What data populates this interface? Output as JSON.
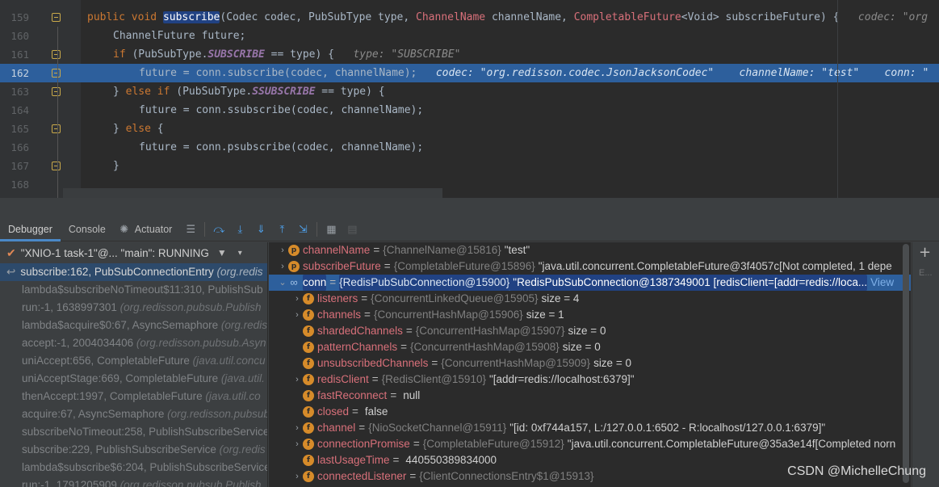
{
  "editor": {
    "line_numbers": [
      "159",
      "160",
      "161",
      "162",
      "163",
      "164",
      "165",
      "166",
      "167",
      "168"
    ],
    "lines": [
      {
        "parts": [
          [
            "kw",
            "public "
          ],
          [
            "kw",
            "void "
          ],
          [
            "sel",
            "subscribe"
          ],
          [
            "ty",
            "(Codec codec, PubSubType type, "
          ],
          [
            "red",
            "ChannelName"
          ],
          [
            "ty",
            " channelName, "
          ],
          [
            "red",
            "CompletableFuture"
          ],
          [
            "ty",
            "<Void> subscribeFuture) {   "
          ],
          [
            "hint",
            "codec: \"org"
          ]
        ]
      },
      {
        "parts": [
          [
            "ty",
            "ChannelFuture future;"
          ]
        ]
      },
      {
        "parts": [
          [
            "kw",
            "if "
          ],
          [
            "ty",
            "(PubSubType."
          ],
          [
            "en",
            "SUBSCRIBE"
          ],
          [
            "ty",
            " == type) {   "
          ],
          [
            "hint",
            "type: \"SUBSCRIBE\""
          ]
        ]
      },
      {
        "parts": [
          [
            "ty",
            "future = conn.subscribe(codec, channelName);   "
          ],
          [
            "hlnote",
            "codec: \"org.redisson.codec.JsonJacksonCodec\"    channelName: \"test\"    conn: \""
          ]
        ]
      },
      {
        "parts": [
          [
            "ty",
            "} "
          ],
          [
            "kw",
            "else if "
          ],
          [
            "ty",
            "(PubSubType."
          ],
          [
            "en",
            "SSUBSCRIBE"
          ],
          [
            "ty",
            " == type) {"
          ]
        ]
      },
      {
        "parts": [
          [
            "ty",
            "future = conn.ssubscribe(codec, channelName);"
          ]
        ]
      },
      {
        "parts": [
          [
            "ty",
            "} "
          ],
          [
            "kw",
            "else "
          ],
          [
            "ty",
            "{"
          ]
        ]
      },
      {
        "parts": [
          [
            "ty",
            "future = conn.psubscribe(codec, channelName);"
          ]
        ]
      },
      {
        "parts": [
          [
            "ty",
            "}"
          ]
        ]
      },
      {
        "parts": []
      }
    ]
  },
  "debug": {
    "tabs": {
      "debugger": "Debugger",
      "console": "Console",
      "actuator": "Actuator"
    },
    "thread": "\"XNIO-1 task-1\"@... \"main\": RUNNING",
    "frames": [
      {
        "method": "subscribe:162, PubSubConnectionEntry",
        "cls": "(org.redis"
      },
      {
        "method": "lambda$subscribeNoTimeout$11:310, PublishSub",
        "cls": ""
      },
      {
        "method": "run:-1, 1638997301",
        "cls": "(org.redisson.pubsub.Publish"
      },
      {
        "method": "lambda$acquire$0:67, AsyncSemaphore",
        "cls": "(org.redis"
      },
      {
        "method": "accept:-1, 2004034406",
        "cls": "(org.redisson.pubsub.Asyn"
      },
      {
        "method": "uniAccept:656, CompletableFuture",
        "cls": "(java.util.concu"
      },
      {
        "method": "uniAcceptStage:669, CompletableFuture",
        "cls": "(java.util."
      },
      {
        "method": "thenAccept:1997, CompletableFuture",
        "cls": "(java.util.co"
      },
      {
        "method": "acquire:67, AsyncSemaphore",
        "cls": "(org.redisson.pubsub"
      },
      {
        "method": "subscribeNoTimeout:258, PublishSubscribeService",
        "cls": ""
      },
      {
        "method": "subscribe:229, PublishSubscribeService",
        "cls": "(org.redis"
      },
      {
        "method": "lambda$subscribe$6:204, PublishSubscribeService",
        "cls": ""
      },
      {
        "method": "run:-1, 1791205909",
        "cls": "(org.redisson.pubsub.Publish"
      }
    ],
    "variables": [
      {
        "indent": 0,
        "arrow": "›",
        "icon": "p",
        "name": "channelName",
        "type": "{ChannelName@15816}",
        "value": "\"test\"",
        "selected": false
      },
      {
        "indent": 0,
        "arrow": "›",
        "icon": "p",
        "name": "subscribeFuture",
        "type": "{CompletableFuture@15896}",
        "value": "\"java.util.concurrent.CompletableFuture@3f4057c[Not completed, 1 depe",
        "selected": false
      },
      {
        "indent": 0,
        "arrow": "⌄",
        "icon": "oo",
        "name": "conn",
        "type": "{RedisPubSubConnection@15900}",
        "value": "\"RedisPubSubConnection@1387349001 [redisClient=[addr=redis://loca...",
        "link": "View",
        "selected": true
      },
      {
        "indent": 1,
        "arrow": "›",
        "icon": "f",
        "name": "listeners",
        "type": "{ConcurrentLinkedQueue@15905}",
        "value": "size = 4",
        "selected": false
      },
      {
        "indent": 1,
        "arrow": "›",
        "icon": "f",
        "name": "channels",
        "type": "{ConcurrentHashMap@15906}",
        "value": "size = 1",
        "selected": false
      },
      {
        "indent": 1,
        "arrow": "",
        "icon": "f",
        "name": "shardedChannels",
        "type": "{ConcurrentHashMap@15907}",
        "value": "size = 0",
        "selected": false
      },
      {
        "indent": 1,
        "arrow": "",
        "icon": "f",
        "name": "patternChannels",
        "type": "{ConcurrentHashMap@15908}",
        "value": "size = 0",
        "selected": false
      },
      {
        "indent": 1,
        "arrow": "",
        "icon": "f",
        "name": "unsubscribedChannels",
        "type": "{ConcurrentHashMap@15909}",
        "value": "size = 0",
        "selected": false
      },
      {
        "indent": 1,
        "arrow": "›",
        "icon": "f",
        "name": "redisClient",
        "type": "{RedisClient@15910}",
        "value": "\"[addr=redis://localhost:6379]\"",
        "selected": false
      },
      {
        "indent": 1,
        "arrow": "",
        "icon": "f",
        "name": "fastReconnect",
        "type": "",
        "value": "null",
        "selected": false
      },
      {
        "indent": 1,
        "arrow": "",
        "icon": "f",
        "name": "closed",
        "type": "",
        "value": "false",
        "selected": false
      },
      {
        "indent": 1,
        "arrow": "›",
        "icon": "f",
        "name": "channel",
        "type": "{NioSocketChannel@15911}",
        "value": "\"[id: 0xf744a157, L:/127.0.0.1:6502 - R:localhost/127.0.0.1:6379]\"",
        "selected": false
      },
      {
        "indent": 1,
        "arrow": "›",
        "icon": "f",
        "name": "connectionPromise",
        "type": "{CompletableFuture@15912}",
        "value": "\"java.util.concurrent.CompletableFuture@35a3e14f[Completed norn",
        "selected": false
      },
      {
        "indent": 1,
        "arrow": "",
        "icon": "f",
        "name": "lastUsageTime",
        "type": "",
        "value": "440550389834000",
        "selected": false
      },
      {
        "indent": 1,
        "arrow": "›",
        "icon": "f",
        "name": "connectedListener",
        "type": "{ClientConnectionsEntry$1@15913}",
        "value": "",
        "selected": false
      }
    ],
    "right_ellipsis": "E...",
    "watermark": "CSDN @MichelleChung"
  }
}
